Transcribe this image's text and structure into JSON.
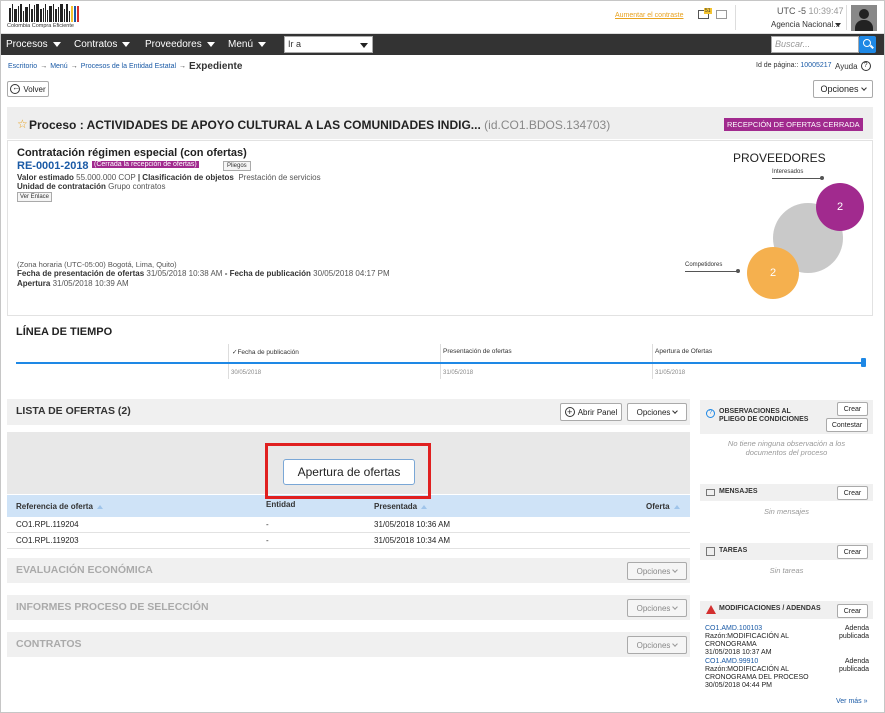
{
  "header": {
    "logo_caption": "Colombia Compra Eficiente",
    "contrast_link": "Aumentar el contraste",
    "notif_badge": "51",
    "timezone": "UTC -5",
    "time": "10:39:47",
    "agency": "Agencia Nacional..."
  },
  "nav": {
    "items": [
      "Procesos",
      "Contratos",
      "Proveedores",
      "Menú"
    ],
    "go_to": "Ir a",
    "search_placeholder": "Buscar..."
  },
  "breadcrumb": {
    "items": [
      "Escritorio",
      "Menú",
      "Procesos de la Entidad Estatal"
    ],
    "current": "Expediente"
  },
  "page_id": {
    "label": "Id de página::",
    "value": "10005217"
  },
  "help_label": "Ayuda",
  "help_glyph": "?",
  "back_label": "Volver",
  "options_label": "Opciones",
  "process": {
    "title": "Proceso : ACTIVIDADES DE APOYO CULTURAL A LAS COMUNIDADES INDIG...",
    "id": "(id.CO1.BDOS.134703)",
    "status": "RECEPCIÓN DE OFERTAS CERRADA",
    "contract_type": "Contratación régimen especial (con ofertas)",
    "reference": "RE-0001-2018",
    "reference_status": "(Cerrada la recepción de ofertas)",
    "pliegos_label": "Pliegos",
    "valor_label": "Valor estimado",
    "valor": "55.000.000 COP",
    "clasif_label": "| Clasificación de objetos",
    "clasif": "Prestación de servicios",
    "unidad_label": "Unidad de contratación",
    "unidad": "Grupo contratos",
    "ver_enlace": "Ver Enlace",
    "zona": "(Zona horaria (UTC-05:00) Bogotá, Lima, Quito)",
    "fecha_pres_label": "Fecha de presentación de ofertas",
    "fecha_pres": "31/05/2018 10:38 AM",
    "fecha_pub_label": "- Fecha de publicación",
    "fecha_pub": "30/05/2018 04:17 PM",
    "apertura_label": "Apertura",
    "apertura": "31/05/2018 10:39 AM"
  },
  "proveedores": {
    "title": "PROVEEDORES",
    "interesados_label": "Interesados",
    "interesados": "2",
    "competidores_label": "Competidores",
    "competidores": "2",
    "colors": {
      "interesados": "#a12a8e",
      "competidores": "#f5b04e",
      "total": "#c9c9c9"
    }
  },
  "timeline": {
    "title": "LÍNEA DE TIEMPO",
    "events": [
      {
        "label": "Fecha de publicación",
        "date": "30/05/2018"
      },
      {
        "label": "Presentación de ofertas",
        "date": "31/05/2018"
      },
      {
        "label": "Apertura de Ofertas",
        "date": "31/05/2018"
      }
    ]
  },
  "ofertas": {
    "title": "LISTA DE OFERTAS (2)",
    "abrir_panel": "Abrir Panel",
    "options": "Opciones",
    "apertura_button": "Apertura de ofertas",
    "columns": [
      "Referencia de oferta",
      "Entidad",
      "Presentada",
      "Oferta"
    ],
    "rows": [
      [
        "CO1.RPL.119204",
        "-",
        "31/05/2018 10:36 AM",
        ""
      ],
      [
        "CO1.RPL.119203",
        "-",
        "31/05/2018 10:34 AM",
        ""
      ]
    ]
  },
  "sections": [
    {
      "title": "EVALUACIÓN ECONÓMICA",
      "options": "Opciones"
    },
    {
      "title": "INFORMES PROCESO DE SELECCIÓN",
      "options": "Opciones"
    },
    {
      "title": "CONTRATOS",
      "options": "Opciones"
    }
  ],
  "sidebar": {
    "observaciones": {
      "title": "OBSERVACIONES AL PLIEGO DE CONDICIONES",
      "crear": "Crear",
      "contestar": "Contestar",
      "empty": "No tiene ninguna observación a los documentos del proceso"
    },
    "mensajes": {
      "title": "MENSAJES",
      "crear": "Crear",
      "empty": "Sin mensajes"
    },
    "tareas": {
      "title": "TAREAS",
      "crear": "Crear",
      "empty": "Sin tareas"
    },
    "modificaciones": {
      "title": "MODIFICACIONES / ADENDAS",
      "crear": "Crear",
      "items": [
        {
          "id": "CO1.AMD.100103",
          "razon": "Razón:MODIFICACIÓN AL CRONOGRAMA",
          "fecha": "31/05/2018 10:37 AM",
          "estado": "Adenda publicada"
        },
        {
          "id": "CO1.AMD.99910",
          "razon": "Razón:MODIFICACIÓN AL CRONOGRAMA DEL PROCESO",
          "fecha": "30/05/2018 04:44 PM",
          "estado": "Adenda publicada"
        }
      ],
      "ver_mas": "Ver más »"
    }
  }
}
